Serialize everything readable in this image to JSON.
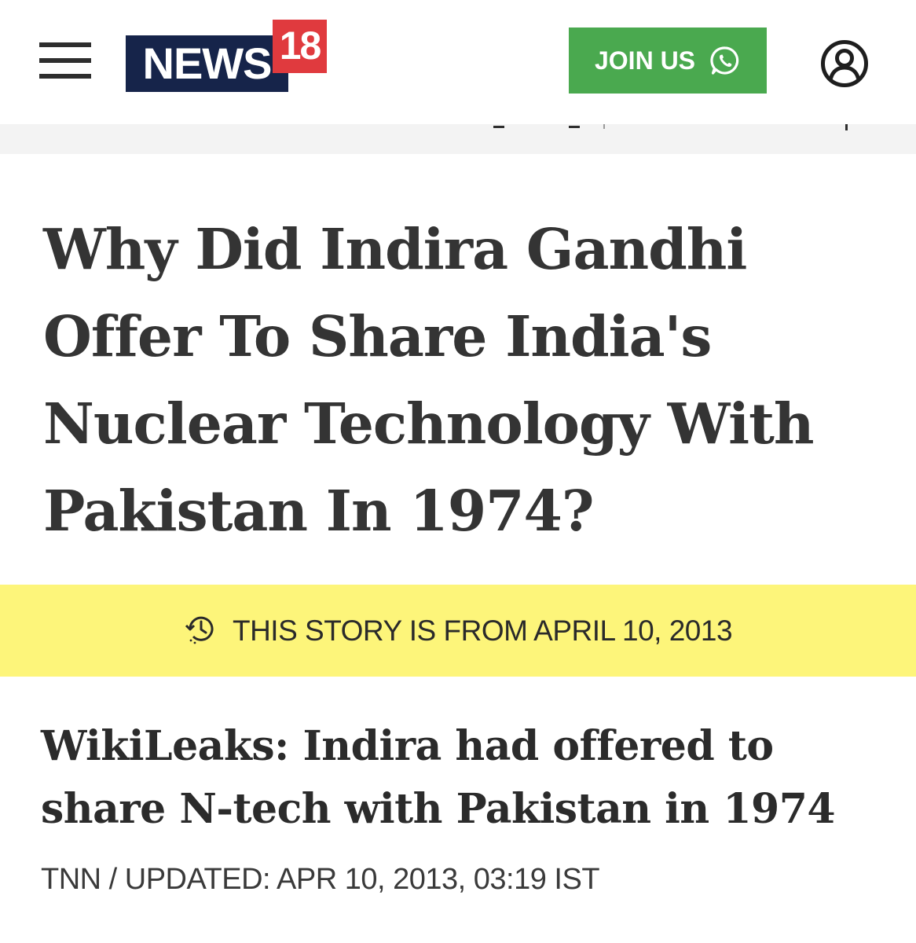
{
  "header": {
    "logo_text": "NEWS",
    "logo_number": "18",
    "join_label": "JOIN US",
    "join_icon": "whatsapp-icon",
    "menu_icon": "hamburger-icon",
    "profile_icon": "user-icon",
    "colors": {
      "logo_navy": "#16244a",
      "logo_red": "#e03a3e",
      "join_green": "#4aa94f"
    }
  },
  "article": {
    "headline": "Why Did Indira Gandhi Offer To Share India's Nuclear Technology With Pakistan In 1974?",
    "banner": {
      "icon": "history-clock-icon",
      "text": "THIS STORY IS FROM APRIL 10, 2013",
      "color": "#fdf57a"
    },
    "subheadline": "WikiLeaks: Indira had offered to share N-tech with Pakistan in 1974",
    "byline": "TNN / UPDATED: APR 10, 2013, 03:19 IST"
  }
}
